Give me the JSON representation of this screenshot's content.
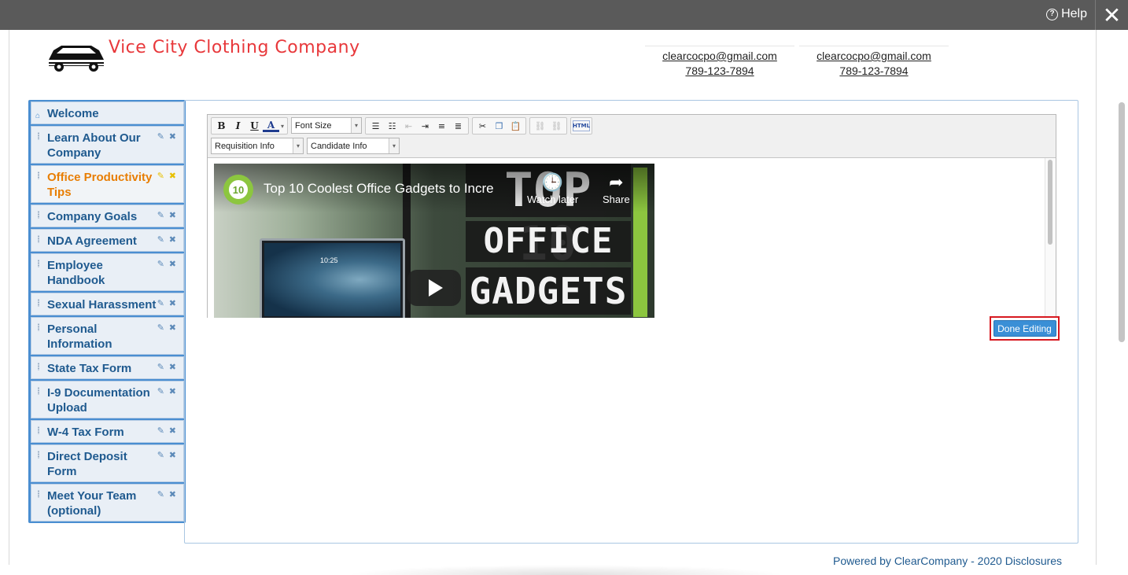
{
  "topbar": {
    "help_label": "Help",
    "help_icon": "?",
    "close_icon": "✕"
  },
  "header": {
    "company_name": "Vice City Clothing Company",
    "contacts": [
      {
        "email": "clearcocpo@gmail.com",
        "phone": "789-123-7894"
      },
      {
        "email": "clearcocpo@gmail.com",
        "phone": "789-123-7894"
      }
    ]
  },
  "sidebar": {
    "items": [
      {
        "label": "Welcome",
        "icon": "home-icon"
      },
      {
        "label": "Learn About Our Company"
      },
      {
        "label": "Office Productivity Tips",
        "active": true
      },
      {
        "label": "Company Goals"
      },
      {
        "label": "NDA Agreement"
      },
      {
        "label": "Employee Handbook"
      },
      {
        "label": "Sexual Harassment"
      },
      {
        "label": "Personal Information"
      },
      {
        "label": "State Tax Form"
      },
      {
        "label": "I-9 Documentation Upload"
      },
      {
        "label": "W-4 Tax Form"
      },
      {
        "label": "Direct Deposit Form"
      },
      {
        "label": "Meet Your Team (optional)"
      }
    ],
    "edit_icon": "✎",
    "delete_icon": "✖",
    "home_glyph": "⌂"
  },
  "editor": {
    "bold": "B",
    "italic": "I",
    "underline": "U",
    "color": "A",
    "font_size": "Font Size",
    "html": "HTML",
    "requisition_info": "Requisition Info",
    "candidate_info": "Candidate Info",
    "arrow": "▾"
  },
  "video": {
    "badge": "10",
    "title": "Top 10 Coolest Office Gadgets to Incre",
    "watch_later": "Watch later",
    "share": "Share",
    "thumb_line1": "TOP 10",
    "thumb_line2": "OFFICE",
    "thumb_line3": "GADGETS",
    "monitor_time": "10:25"
  },
  "done_editing": "Done Editing",
  "footer": {
    "powered": "Powered by ClearCompany",
    "separator": " - ",
    "year": "2020",
    "disclosures": "Disclosures"
  },
  "colors": {
    "accent": "#4a8ed1",
    "active": "#e87e04",
    "brand_red": "#e8383b",
    "topbar": "#5a5a5a"
  }
}
